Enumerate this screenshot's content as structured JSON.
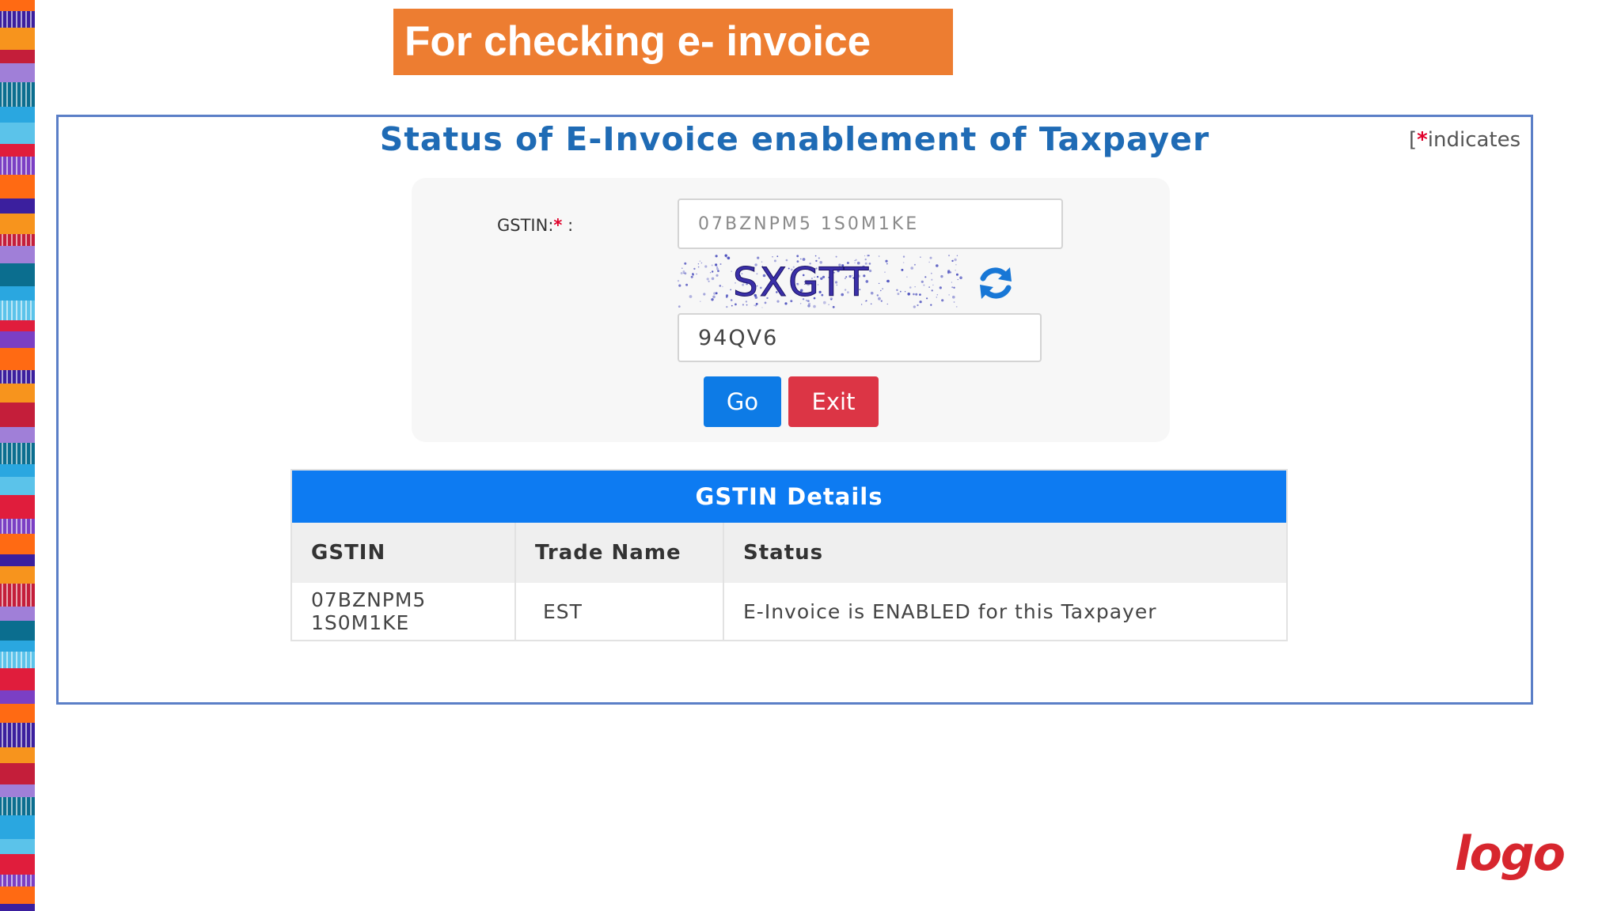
{
  "slide": {
    "title": "For checking e- invoice",
    "logo_text": "logo",
    "accent_color": "#ed7d31"
  },
  "panel": {
    "title": "Status of E-Invoice enablement of Taxpayer",
    "required_note_open": "[",
    "required_note_star": "*",
    "required_note_text": "indicates"
  },
  "form": {
    "gstin_label": "GSTIN:",
    "gstin_required": "*",
    "gstin_colon": ":",
    "gstin_value": "07BZNPM5 1S0M1KE",
    "captcha_text": "SXGTT",
    "captcha_value": "94QV6",
    "go_label": "Go",
    "exit_label": "Exit",
    "refresh_icon": "refresh-icon"
  },
  "details": {
    "heading": "GSTIN Details",
    "columns": [
      "GSTIN",
      "Trade Name",
      "Status"
    ],
    "rows": [
      {
        "gstin": "07BZNPM5 1S0M1KE",
        "trade_name": "EST",
        "status": "E-Invoice is ENABLED for this Taxpayer"
      }
    ],
    "header_color": "#0d7bf2"
  },
  "buttons": {
    "go_color": "#0d7be6",
    "exit_color": "#dc3545"
  }
}
